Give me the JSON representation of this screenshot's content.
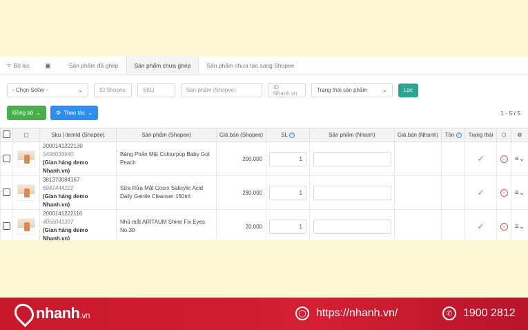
{
  "tabs": [
    {
      "label": "Bộ lọc",
      "icon": "filter-icon"
    },
    {
      "label": "",
      "icon": "save-icon"
    },
    {
      "label": "Sản phẩm đã ghép"
    },
    {
      "label": "Sản phẩm chưa ghép",
      "active": true
    },
    {
      "label": "Sản phẩm chưa tạo sang Shopee"
    }
  ],
  "filters": {
    "seller": "- Chọn Seller -",
    "id_shopee": "ID Shopee",
    "sku": "SKU",
    "product_shopee": "Sản phẩm (Shopee)",
    "id_nhanh": "ID Nhanh.vn",
    "status": "Trạng thái sản phẩm",
    "filter_button": "Lọc"
  },
  "actions": {
    "sync": "Đồng bộ",
    "operations": "Thao tác",
    "pager": "1 - 5 / 5"
  },
  "columns": {
    "sku": "Sku | itemId (Shopee)",
    "product_shopee": "Sản phẩm (Shopee)",
    "price_shopee": "Giá bán (Shopee)",
    "qty": "SL",
    "product_nhanh": "Sản phẩm (Nhanh)",
    "price_nhanh": "Giá bán (Nhanh)",
    "stock": "Tồn",
    "status": "Trạng thái"
  },
  "rows": [
    {
      "sku": "2000141222130",
      "item_id": "5456039940",
      "shop": "(Gian hàng demo Nhanh.vn)",
      "product": "Bảng Phấn Mặt Colourpop Baby Got Peach",
      "price": "200.000",
      "qty": "1"
    },
    {
      "sku": "381370084167",
      "item_id": "6941444222",
      "shop": "(Gian hàng demo Nhanh.vn)",
      "product": "Sữa Rửa Mặt Cosrx Salicylic Acid Daily Gentle Cleanser 150ml",
      "price": "280.000",
      "qty": "1"
    },
    {
      "sku": "2000141222116",
      "item_id": "4056041397",
      "shop": "(Gian hàng demo Nhanh.vn)",
      "product": "Nhũ mắt ARITAUM Shine Fix Eyes No.30",
      "price": "20.000",
      "qty": "1"
    }
  ],
  "banner": {
    "brand": "nhanh",
    "brand_suffix": ".vn",
    "website": "https://nhanh.vn/",
    "hotline": "1900 2812"
  },
  "colors": {
    "accent_teal": "#2aa592",
    "green": "#47b04b",
    "blue": "#2c8ef0",
    "banner_red": "#d51e33"
  }
}
